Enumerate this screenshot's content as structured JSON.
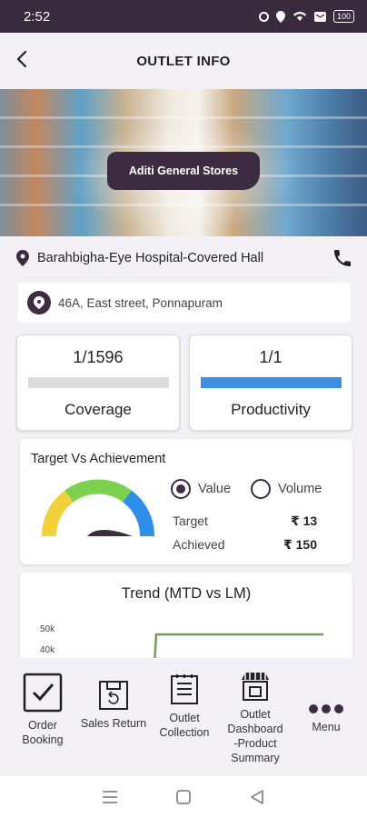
{
  "status_bar": {
    "time": "2:52",
    "battery": "100"
  },
  "header": {
    "title": "OUTLET INFO",
    "back_icon": "back-arrow-icon"
  },
  "banner": {
    "store_name": "Aditi General Stores"
  },
  "location": {
    "name": "Barahbigha-Eye Hospital-Covered Hall",
    "pin_icon": "map-pin-icon",
    "phone_icon": "phone-icon"
  },
  "address": {
    "text": "46A, East street, Ponnapuram",
    "icon": "location-marker-icon"
  },
  "coverage": {
    "value": "1/1596",
    "label": "Coverage",
    "progress": 0.0
  },
  "productivity": {
    "value": "1/1",
    "label": "Productivity",
    "progress": 1.0
  },
  "target": {
    "title": "Target Vs Achievement",
    "options": [
      {
        "label": "Value",
        "selected": true
      },
      {
        "label": "Volume",
        "selected": false
      }
    ],
    "rows": [
      {
        "label": "Target",
        "value": "₹ 13"
      },
      {
        "label": "Achieved",
        "value": "₹ 150"
      }
    ],
    "gauge_colors": [
      "#f2d13b",
      "#7cd14f",
      "#2f8ee8"
    ]
  },
  "trend": {
    "title": "Trend (MTD vs LM)",
    "tick_labels": [
      "50k",
      "40k"
    ],
    "line_color": "#7a9a59"
  },
  "bottom_nav": [
    {
      "label": "Order\nBooking",
      "icon": "order-booking-icon"
    },
    {
      "label": "Sales Return",
      "icon": "sales-return-icon"
    },
    {
      "label": "Outlet\nCollection",
      "icon": "outlet-collection-icon"
    },
    {
      "label": "Outlet\nDashboard\n-Product\nSummary",
      "icon": "store-icon"
    },
    {
      "label": "Menu",
      "icon": "more-dots-icon"
    }
  ],
  "colors": {
    "brand": "#3d2c41",
    "accent": "#3d8fe3"
  }
}
